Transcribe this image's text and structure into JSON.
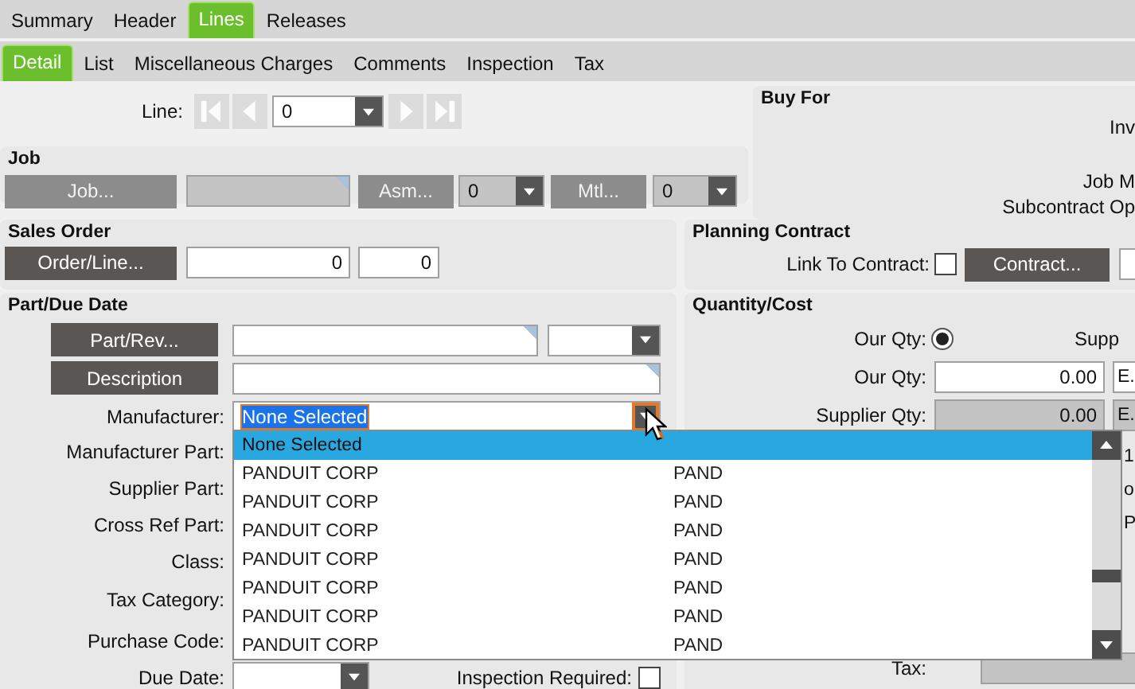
{
  "top_tabs": [
    {
      "label": "Summary",
      "selected": false
    },
    {
      "label": "Header",
      "selected": false
    },
    {
      "label": "Lines",
      "selected": true
    },
    {
      "label": "Releases",
      "selected": false
    }
  ],
  "sub_tabs": [
    {
      "label": "Detail",
      "selected": true
    },
    {
      "label": "List",
      "selected": false
    },
    {
      "label": "Miscellaneous Charges",
      "selected": false
    },
    {
      "label": "Comments",
      "selected": false
    },
    {
      "label": "Inspection",
      "selected": false
    },
    {
      "label": "Tax",
      "selected": false
    }
  ],
  "line": {
    "label": "Line:",
    "value": "0",
    "navigation_disabled": true
  },
  "job": {
    "title": "Job",
    "disabled": true,
    "job_button": "Job...",
    "asm_button": "Asm...",
    "asm_value": "0",
    "mtl_button": "Mtl...",
    "mtl_value": "0"
  },
  "buy_for": {
    "title": "Buy For",
    "labels": [
      "Inv",
      "Job M",
      "Subcontract Op"
    ]
  },
  "sales_order": {
    "title": "Sales Order",
    "button": "Order/Line...",
    "order": "0",
    "line": "0"
  },
  "planning_contract": {
    "title": "Planning Contract",
    "link_label": "Link To Contract:",
    "link_checked": false,
    "button": "Contract..."
  },
  "part_due_date": {
    "title": "Part/Due Date",
    "part_button": "Part/Rev...",
    "description_button": "Description",
    "manufacturer_label": "Manufacturer:",
    "manufacturer_value": "None Selected",
    "labels": [
      "Manufacturer Part:",
      "Supplier Part:",
      "Cross Ref Part:",
      "Class:",
      "Tax Category:",
      "Purchase Code:"
    ],
    "due_date_label": "Due Date:",
    "inspection_label": "Inspection Required:",
    "inspection_checked": false
  },
  "manufacturer_list": {
    "options": [
      {
        "name": "None Selected",
        "selected": true
      },
      {
        "name": "PANDUIT CORP",
        "code": "PAND",
        "selected": false
      },
      {
        "name": "PANDUIT CORP",
        "code": "PAND",
        "selected": false
      },
      {
        "name": "PANDUIT CORP",
        "code": "PAND",
        "selected": false
      },
      {
        "name": "PANDUIT CORP",
        "code": "PAND",
        "selected": false
      },
      {
        "name": "PANDUIT CORP",
        "code": "PAND",
        "selected": false
      },
      {
        "name": "PANDUIT CORP",
        "code": "PAND",
        "selected": false
      },
      {
        "name": "PANDUIT CORP",
        "code": "PAND",
        "selected": false
      }
    ]
  },
  "quantity_cost": {
    "title": "Quantity/Cost",
    "radio_label": "Our Qty:",
    "radio_selected": true,
    "supplier_radio_label": "Supp",
    "our_qty_label": "Our Qty:",
    "our_qty": "0.00",
    "our_uom": "E.",
    "supplier_qty_label": "Supplier Qty:",
    "supplier_qty": "0.00",
    "supplier_uom": "E.",
    "hidden_fragments": [
      "1",
      "o",
      "P"
    ],
    "tax_label": "Tax:"
  }
}
